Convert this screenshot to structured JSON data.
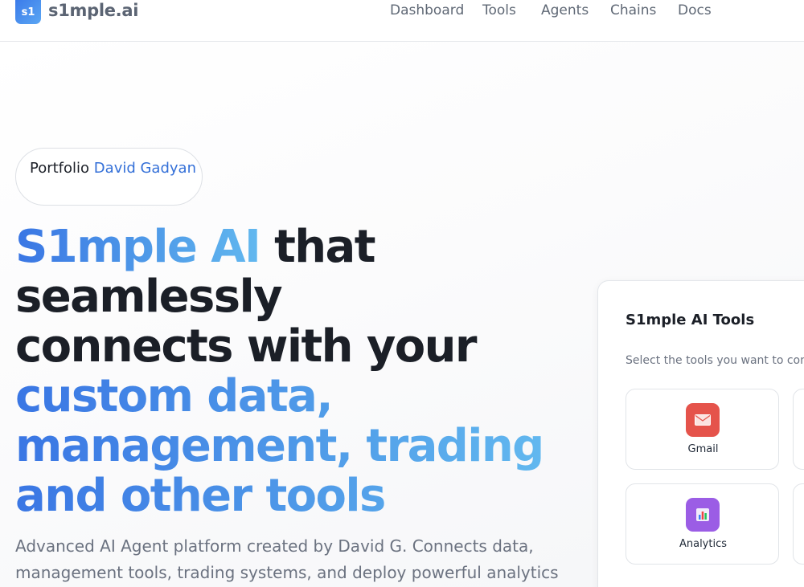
{
  "header": {
    "logo_badge": "s1",
    "logo_text": "s1mple.ai",
    "nav": [
      {
        "label": "Dashboard"
      },
      {
        "label": "Tools"
      },
      {
        "label": "Agents"
      },
      {
        "label": "Chains"
      },
      {
        "label": "Docs"
      }
    ]
  },
  "hero": {
    "pill": {
      "prefix": "Portfolio",
      "name": "David Gadyan"
    },
    "headline": {
      "l1_grad": "S1mple AI",
      "l1_plain": " that",
      "l2": "seamlessly",
      "l3": "connects with your",
      "l4": "custom data,",
      "l5": "management, trading",
      "l6": "and other tools"
    },
    "subtext": "Advanced AI Agent platform created by David G. Connects data, management tools, trading systems, and deploy powerful analytics for all"
  },
  "tools_card": {
    "title": "S1mple AI Tools",
    "description": "Select the tools you want to conn",
    "tiles": [
      {
        "label": "Gmail",
        "icon": "envelope-icon",
        "color": "#e5534b"
      },
      {
        "label": "Analytics",
        "icon": "bar-chart-icon",
        "color": "#9b5de5"
      }
    ]
  },
  "colors": {
    "accent": "#3a76e4",
    "accent_light": "#62b8ef",
    "text_dark": "#1b1f27",
    "text_muted": "#6b7280"
  }
}
